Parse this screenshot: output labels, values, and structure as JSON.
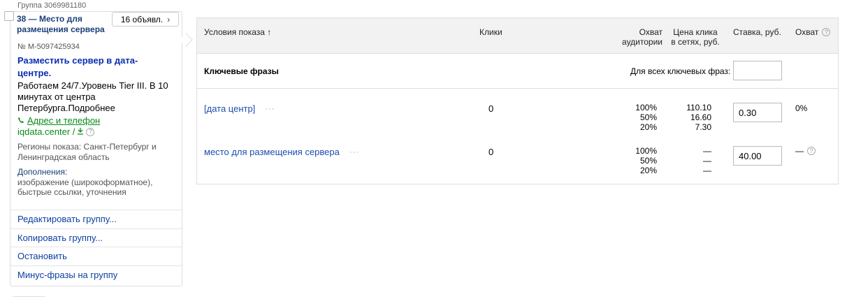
{
  "group": {
    "id_label": "Группа 3069981180",
    "title": "38 — Место для размещения сервера",
    "ads_button": "16 объявл.",
    "ad_number": "№ М-5097425934",
    "ad_title": "Разместить сервер в дата-центре.",
    "ad_text": "Работаем 24/7.Уровень Tier III. В 10 минутах от центра Петербурга.Подробнее",
    "contacts_label": "Адрес и телефон",
    "domain": "iqdata.center /",
    "regions": "Регионы показа: Санкт-Петербург и Ленинградская область",
    "extras_label": "Дополнения:",
    "extras": "изображение (широкоформатное), быстрые ссылки, уточнения",
    "actions": [
      "Редактировать группу...",
      "Копировать группу...",
      "Остановить",
      "Минус-фразы на группу"
    ]
  },
  "table": {
    "headers": {
      "conditions": "Условия показа ↑",
      "clicks": "Клики",
      "reach_line1": "Охват",
      "reach_line2": "аудитории",
      "price_line1": "Цена клика",
      "price_line2": "в сетях, руб.",
      "bid": "Ставка, руб.",
      "coverage": "Охват"
    },
    "keywords_label": "Ключевые фразы",
    "all_keywords_label": "Для всех ключевых фраз:",
    "all_keywords_value": "",
    "rows": [
      {
        "phrase": "[дата центр]",
        "clicks": "0",
        "reach": [
          "100%",
          "50%",
          "20%"
        ],
        "price": [
          "110.10",
          "16.60",
          "7.30"
        ],
        "bid": "0.30",
        "coverage": "0%"
      },
      {
        "phrase": "место для размещения сервера",
        "clicks": "0",
        "reach": [
          "100%",
          "50%",
          "20%"
        ],
        "price": [
          "—",
          "—",
          "—"
        ],
        "bid": "40.00",
        "coverage": "—"
      }
    ]
  },
  "colors": {
    "link_blue": "#1d4cb0",
    "ad_title_blue": "#0a2db2",
    "green_link": "#0b8a1c",
    "header_bg": "#f2f2f2"
  },
  "icons": {
    "contacts": "phone-icon",
    "domain": "download-icon",
    "help": "question-circle-icon",
    "more": "ellipsis-icon",
    "chevron": "chevron-right-icon"
  }
}
